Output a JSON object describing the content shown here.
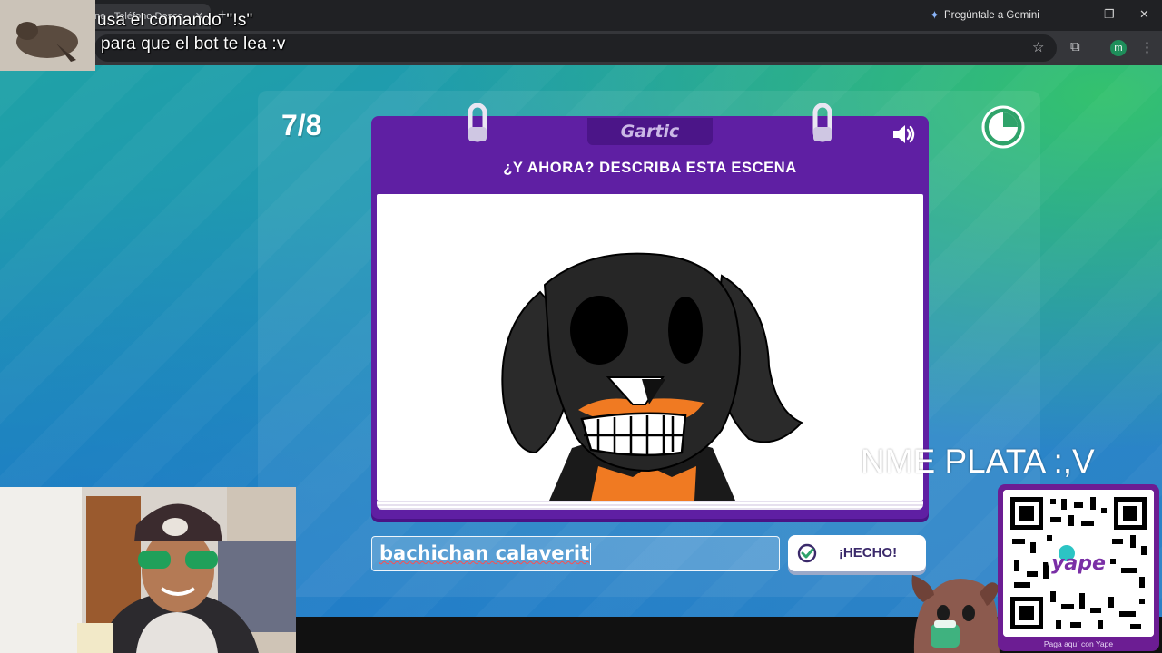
{
  "browser": {
    "tab_title": "ne - Teléfono Desco",
    "tab_close": "✕",
    "new_tab": "+",
    "gemini_label": "Pregúntale a Gemini",
    "profile_initial": "m",
    "minimize": "—",
    "restore": "❐",
    "close": "✕"
  },
  "overlay": {
    "line1": "usa el comando \"!s\"",
    "line2": "para que el bot te lea :v",
    "banner": "NME PLATA :,V",
    "qr_caption": "Paga aquí con Yape",
    "qr_logo": "yape"
  },
  "game": {
    "round": "7/8",
    "logo": "Gartic",
    "instruction": "¿Y AHORA? DESCRIBA ESTA ESCENA",
    "answer_value": "bachichan calaverit",
    "done_label": "¡HECHO!"
  },
  "colors": {
    "notebook": "#5f1fa3",
    "accent_green": "#35c46a",
    "background": "#1f92b8"
  }
}
